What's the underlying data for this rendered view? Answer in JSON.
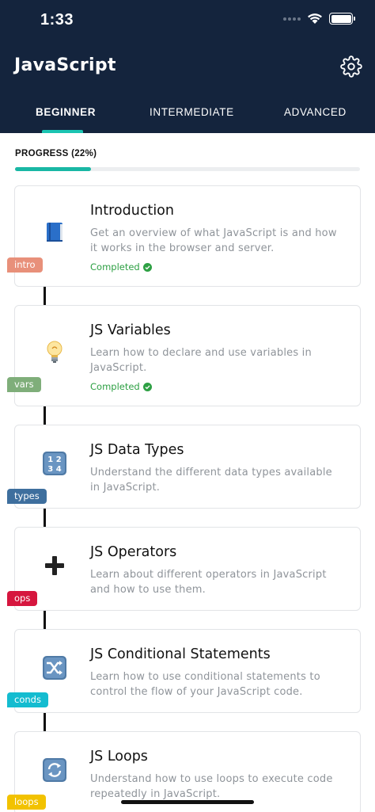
{
  "status_bar": {
    "time": "1:33"
  },
  "header": {
    "title": "JavaScript"
  },
  "tabs": [
    {
      "label": "BEGINNER",
      "active": true
    },
    {
      "label": "INTERMEDIATE",
      "active": false
    },
    {
      "label": "ADVANCED",
      "active": false
    }
  ],
  "progress": {
    "label": "PROGRESS (22%)",
    "percent": 22
  },
  "lessons": [
    {
      "title": "Introduction",
      "description": "Get an overview of what JavaScript is and how it works in the browser and server.",
      "status": "Completed",
      "tag": "intro",
      "tag_color": "#e8907a",
      "icon": "book-icon"
    },
    {
      "title": "JS Variables",
      "description": "Learn how to declare and use variables in JavaScript.",
      "status": "Completed",
      "tag": "vars",
      "tag_color": "#7fae7a",
      "icon": "lightbulb-icon"
    },
    {
      "title": "JS Data Types",
      "description": "Understand the different data types available in JavaScript.",
      "status": "",
      "tag": "types",
      "tag_color": "#3e6f9e",
      "icon": "numbers-icon"
    },
    {
      "title": "JS Operators",
      "description": "Learn about different operators in JavaScript and how to use them.",
      "status": "",
      "tag": "ops",
      "tag_color": "#d6163e",
      "icon": "plus-icon"
    },
    {
      "title": "JS Conditional Statements",
      "description": "Learn how to use conditional statements to control the flow of your JavaScript code.",
      "status": "",
      "tag": "conds",
      "tag_color": "#14bcd0",
      "icon": "shuffle-icon"
    },
    {
      "title": "JS Loops",
      "description": "Understand how to use loops to execute code repeatedly in JavaScript.",
      "status": "",
      "tag": "loops",
      "tag_color": "#f2c200",
      "icon": "repeat-icon"
    }
  ],
  "colors": {
    "header_bg": "#14243d",
    "accent": "#19b7a4",
    "completed": "#2ea044"
  }
}
